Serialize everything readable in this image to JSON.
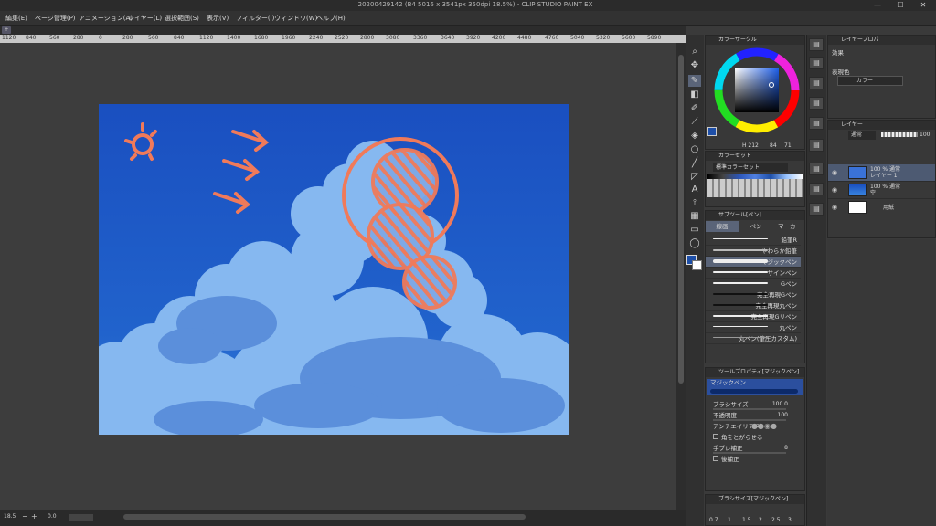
{
  "window": {
    "title": "20200429142 (B4 5016 x 3541px 350dpi 18.5%) - CLIP STUDIO PAINT EX",
    "controls": [
      "—",
      "☐",
      "✕"
    ]
  },
  "menu": [
    "編集(E)",
    "ページ管理(P)",
    "アニメーション(A)",
    "レイヤー(L)",
    "選択範囲(S)",
    "表示(V)",
    "フィルター(I)",
    "ウィンドウ(W)",
    "ヘルプ(H)"
  ],
  "ruler": [
    "1120",
    "840",
    "560",
    "280",
    "0",
    "280",
    "560",
    "840",
    "1120",
    "1400",
    "1680",
    "1960",
    "2240",
    "2520",
    "2800",
    "3080",
    "3360",
    "3640",
    "3920",
    "4200",
    "4480",
    "4760",
    "5040",
    "5320",
    "5600",
    "5890"
  ],
  "color_panel": {
    "title": "カラーサークル",
    "h_label": "H 212",
    "s_label": "84",
    "v_label": "71",
    "main_color": "#1e4fa8"
  },
  "color_set": {
    "title": "カラーセット",
    "name": "標準カラーセット"
  },
  "sub_tool": {
    "title": "サブツール[ペン]",
    "tabs": [
      "線画",
      "ペン",
      "マーカー"
    ],
    "brushes": [
      "鉛筆R",
      "やわらか鉛筆",
      "マジックペン",
      "サインペン",
      "Gペン",
      "完全再現Gペン",
      "完全再現丸ペン",
      "完全再現Gリペン",
      "丸ペン",
      "丸ペン(筆圧カスタム)"
    ],
    "selected_index": 2
  },
  "tool_property": {
    "title": "ツールプロパティ[マジックペン]",
    "brush_name": "マジックペン",
    "rows": [
      {
        "label": "ブラシサイズ",
        "value": "100.0"
      },
      {
        "label": "不透明度",
        "value": "100"
      },
      {
        "label": "アンチエイリアス",
        "value": ""
      },
      {
        "label": "角をとがらせる",
        "value": ""
      },
      {
        "label": "手ブレ補正",
        "value": "8"
      },
      {
        "label": "後補正",
        "value": ""
      }
    ]
  },
  "brush_size_panel": {
    "title": "ブラシサイズ[マジックペン]",
    "sizes": [
      "0.7",
      "1",
      "1.5",
      "2",
      "2.5",
      "3"
    ]
  },
  "layer_property": {
    "title": "レイヤープロパ",
    "effect_label": "効果",
    "color_label": "表現色",
    "color_value": "カラー"
  },
  "layer_panel": {
    "title": "レイヤー",
    "blend": "通常",
    "opacity": "100",
    "layers": [
      {
        "name": "100 % 通常",
        "sub": "レイヤー 1",
        "selected": true
      },
      {
        "name": "100 % 通常",
        "sub": "空",
        "selected": false
      },
      {
        "name": "",
        "sub": "用紙",
        "selected": false
      }
    ]
  },
  "status": {
    "zoom": "18.5",
    "angle": "0.0"
  },
  "colors": {
    "sky_top": "#1a50c2",
    "sky_bottom": "#2b74d8",
    "cloud_light": "#86b8f0",
    "cloud_shadow": "#5b8fdb",
    "annotation": "#f07a5a"
  }
}
